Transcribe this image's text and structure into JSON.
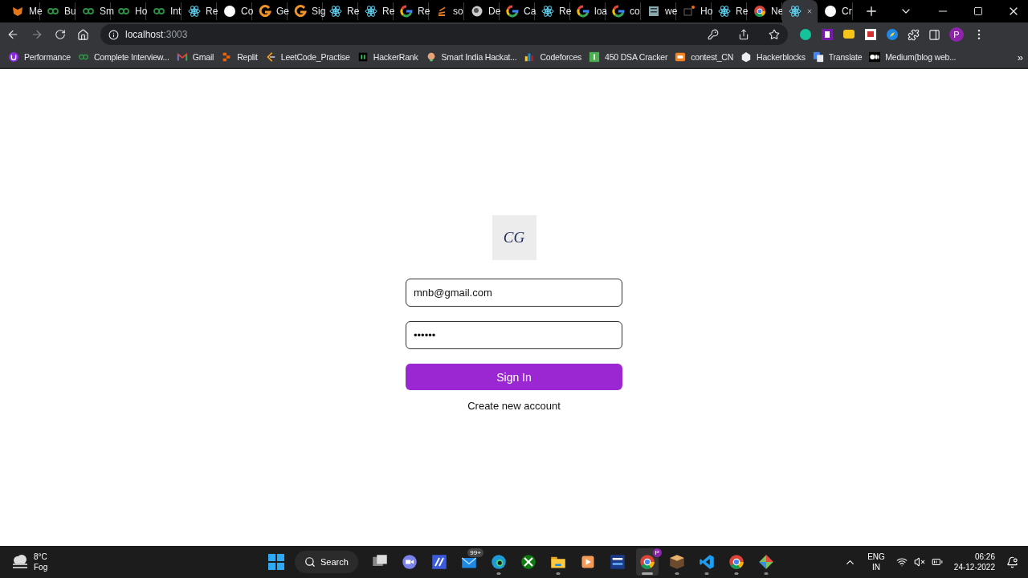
{
  "browser": {
    "tabs": [
      {
        "title": "Me",
        "kind": "fox",
        "selected": false
      },
      {
        "title": "Bu",
        "kind": "gfg",
        "selected": false
      },
      {
        "title": "Sm",
        "kind": "gfg",
        "selected": false
      },
      {
        "title": "Ho",
        "kind": "gfg",
        "selected": false
      },
      {
        "title": "Int",
        "kind": "gfg",
        "selected": false
      },
      {
        "title": "Re",
        "kind": "react",
        "selected": false
      },
      {
        "title": "Co",
        "kind": "github",
        "selected": false
      },
      {
        "title": "Ge",
        "kind": "gorange",
        "selected": false
      },
      {
        "title": "Sig",
        "kind": "gorange",
        "selected": false
      },
      {
        "title": "Re",
        "kind": "react",
        "selected": false
      },
      {
        "title": "Re",
        "kind": "react",
        "selected": false
      },
      {
        "title": "Re",
        "kind": "google",
        "selected": false
      },
      {
        "title": "so",
        "kind": "stack",
        "selected": false
      },
      {
        "title": "De",
        "kind": "globe",
        "selected": false
      },
      {
        "title": "Ca",
        "kind": "google",
        "selected": false
      },
      {
        "title": "Re",
        "kind": "react",
        "selected": false
      },
      {
        "title": "loa",
        "kind": "google",
        "selected": false
      },
      {
        "title": "co",
        "kind": "google",
        "selected": false
      },
      {
        "title": "we",
        "kind": "doc",
        "selected": false
      },
      {
        "title": "Ho",
        "kind": "hc",
        "selected": false
      },
      {
        "title": "Re",
        "kind": "react",
        "selected": false
      },
      {
        "title": "Ne",
        "kind": "chrome",
        "selected": false
      },
      {
        "kind": "react",
        "selected": true
      },
      {
        "title": "Cr",
        "kind": "github",
        "selected": false
      }
    ],
    "address": {
      "host": "localhost",
      "port": ":3003"
    },
    "profile": "P",
    "bookmarks": [
      {
        "label": "Performance",
        "kind": "perf"
      },
      {
        "label": "Complete Interview...",
        "kind": "gfg"
      },
      {
        "label": "Gmail",
        "kind": "gmail"
      },
      {
        "label": "Replit",
        "kind": "replit"
      },
      {
        "label": "LeetCode_Practise",
        "kind": "leetcode"
      },
      {
        "label": "HackerRank",
        "kind": "hackerrank"
      },
      {
        "label": "Smart India Hackat...",
        "kind": "bulb"
      },
      {
        "label": "Codeforces",
        "kind": "bars"
      },
      {
        "label": "450 DSA Cracker",
        "kind": "greensquare"
      },
      {
        "label": "contest_CN",
        "kind": "cn"
      },
      {
        "label": "Hackerblocks",
        "kind": "hb"
      },
      {
        "label": "Translate",
        "kind": "translate"
      },
      {
        "label": "Medium(blog web...",
        "kind": "medium"
      }
    ],
    "bookmarks_overflow": "»"
  },
  "page": {
    "logo": "CG",
    "email": {
      "value": "mnb@gmail.com"
    },
    "password": {
      "value": "••••••"
    },
    "submit": "Sign In",
    "link": "Create new account"
  },
  "taskbar": {
    "weather": {
      "temp": "8°C",
      "condition": "Fog"
    },
    "search": "Search",
    "apps": [
      {
        "kind": "taskview",
        "open": false,
        "selected": false
      },
      {
        "kind": "meet",
        "open": false,
        "selected": false
      },
      {
        "kind": "msapp",
        "open": false,
        "selected": false
      },
      {
        "kind": "mail",
        "open": false,
        "selected": false,
        "badge": "99+"
      },
      {
        "kind": "edge",
        "open": true,
        "selected": false
      },
      {
        "kind": "xbox",
        "open": false,
        "selected": false
      },
      {
        "kind": "folder",
        "open": true,
        "selected": false
      },
      {
        "kind": "media",
        "open": false,
        "selected": false
      },
      {
        "kind": "devcx",
        "open": false,
        "selected": false
      },
      {
        "kind": "chrome",
        "open": true,
        "selected": true,
        "badge": "P"
      },
      {
        "kind": "box",
        "open": true,
        "selected": false
      },
      {
        "kind": "vscode",
        "open": true,
        "selected": false
      },
      {
        "kind": "chrome",
        "open": true,
        "selected": false
      },
      {
        "kind": "git",
        "open": true,
        "selected": false
      }
    ],
    "tray": {
      "lang": "ENG",
      "region": "IN",
      "time": "06:26",
      "date": "24-12-2022"
    }
  }
}
